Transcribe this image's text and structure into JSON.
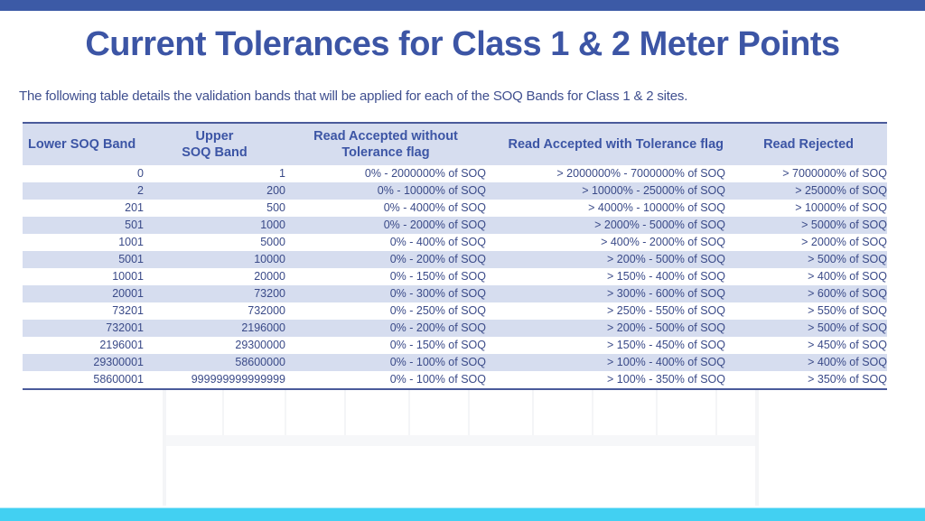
{
  "slide": {
    "title": "Current Tolerances for Class 1 & 2 Meter Points",
    "subtitle": "The following table details the validation bands that will be applied for each of the SOQ Bands for Class 1 & 2 sites.",
    "colors": {
      "accent_top": "#3c5aa6",
      "accent_bottom": "#42d0f2",
      "title": "#3c55a5",
      "row_alt": "#d6ddef"
    }
  },
  "table": {
    "headers": [
      "Lower SOQ Band",
      "Upper SOQ Band",
      "Read Accepted without Tolerance flag",
      "Read Accepted with Tolerance flag",
      "Read Rejected"
    ],
    "rows": [
      [
        "0",
        "1",
        "0% - 2000000% of SOQ",
        "> 2000000% - 7000000% of SOQ",
        "> 7000000% of SOQ"
      ],
      [
        "2",
        "200",
        "0% - 10000% of SOQ",
        "> 10000% - 25000% of SOQ",
        "> 25000% of SOQ"
      ],
      [
        "201",
        "500",
        "0% - 4000% of SOQ",
        "> 4000% - 10000% of SOQ",
        "> 10000% of SOQ"
      ],
      [
        "501",
        "1000",
        "0% - 2000% of SOQ",
        "> 2000% - 5000% of SOQ",
        "> 5000% of SOQ"
      ],
      [
        "1001",
        "5000",
        "0% - 400% of SOQ",
        "> 400% - 2000% of SOQ",
        "> 2000% of SOQ"
      ],
      [
        "5001",
        "10000",
        "0% - 200% of SOQ",
        "> 200% - 500% of SOQ",
        "> 500% of SOQ"
      ],
      [
        "10001",
        "20000",
        "0% - 150% of SOQ",
        "> 150% - 400% of SOQ",
        "> 400% of SOQ"
      ],
      [
        "20001",
        "73200",
        "0% - 300% of SOQ",
        "> 300% - 600% of SOQ",
        "> 600% of SOQ"
      ],
      [
        "73201",
        "732000",
        "0% - 250% of SOQ",
        "> 250% - 550% of SOQ",
        "> 550% of SOQ"
      ],
      [
        "732001",
        "2196000",
        "0% - 200% of SOQ",
        "> 200% - 500% of SOQ",
        "> 500% of SOQ"
      ],
      [
        "2196001",
        "29300000",
        "0% - 150% of SOQ",
        "> 150% - 450% of SOQ",
        "> 450% of SOQ"
      ],
      [
        "29300001",
        "58600000",
        "0% - 100% of SOQ",
        "> 100% - 400% of SOQ",
        "> 400% of SOQ"
      ],
      [
        "58600001",
        "999999999999999",
        "0% - 100% of SOQ",
        "> 100% - 350% of SOQ",
        "> 350% of SOQ"
      ]
    ]
  }
}
